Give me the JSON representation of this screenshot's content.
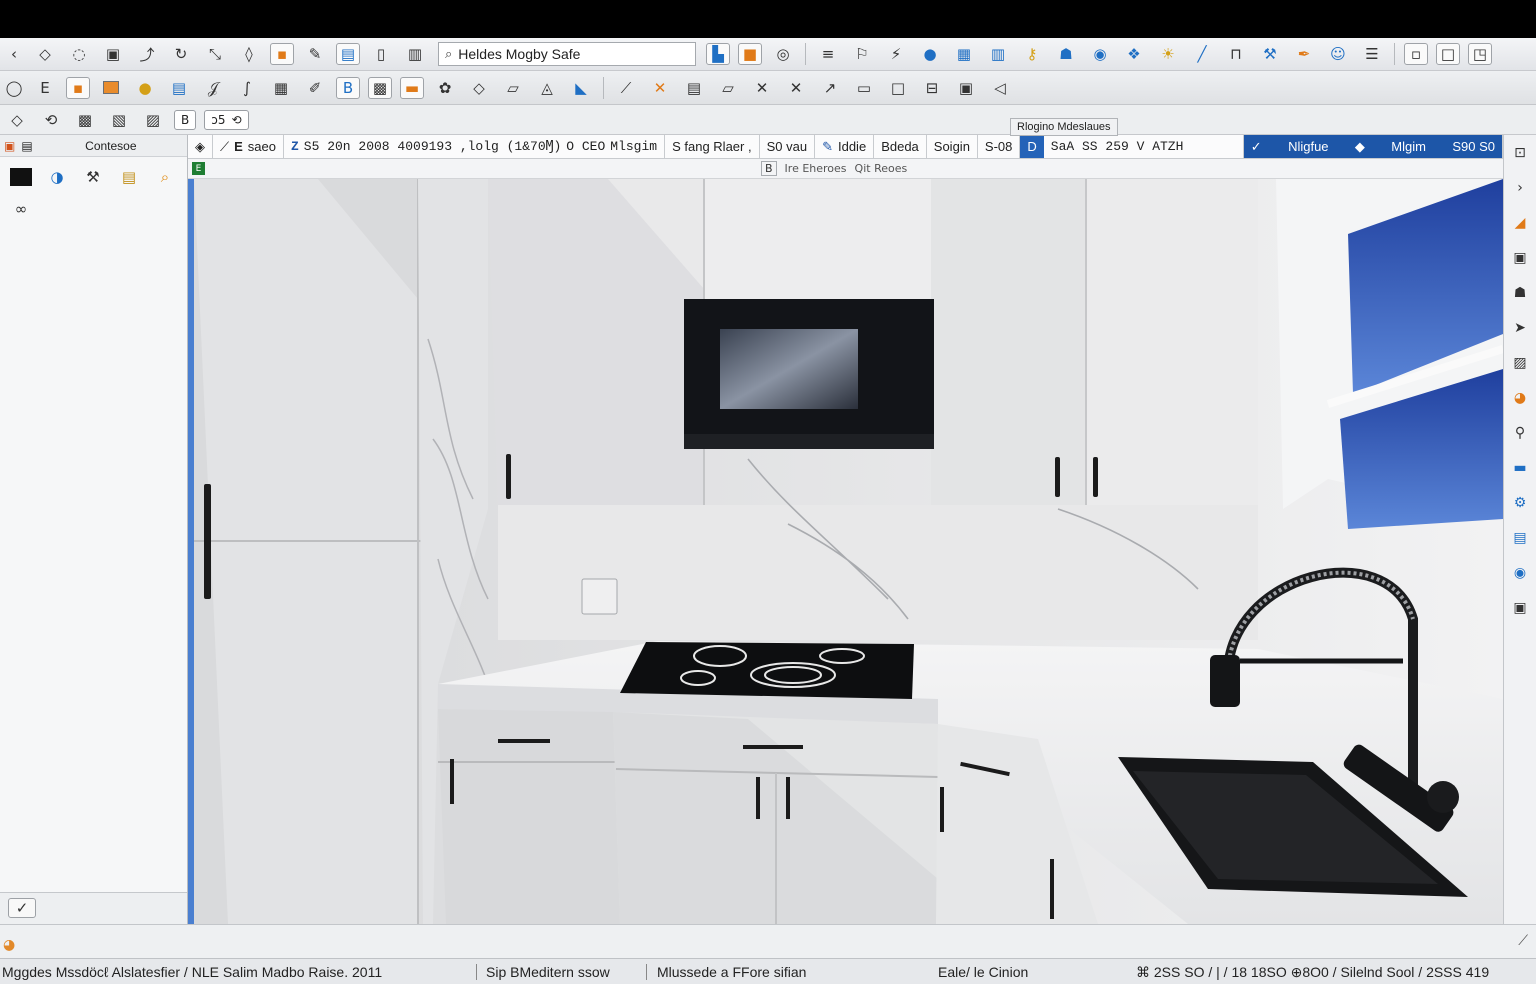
{
  "toolbar1": {
    "search_value": "Heldes Mogby Safe"
  },
  "toolbar3": {
    "pill_b": "B",
    "pill_text": "ɔ5"
  },
  "left_panel": {
    "title": "Contesoe"
  },
  "tooltip": "Rlogino Mdeslaues",
  "info_bar": {
    "e_label": "E",
    "e_value": "saeo",
    "path": "S5 20n 2008 4009193 ,lolg (1&70Ɱ)",
    "oce": "O CEO",
    "height_label": "Mlsgim",
    "scale": "S fang Rlaer ,",
    "units": "S0 vau",
    "mode": "Iddie",
    "bdeda": "Bdeda",
    "soigin": "Soigin",
    "offset": "S-08",
    "coord_label": "SaA SS 259 V ATZH",
    "nav_left": "Nligfue",
    "nav_mid": "Mlgim",
    "nav_right": "S90 S0"
  },
  "sub_bar": {
    "b_label": "B",
    "left_text": "Ire Eheroes",
    "right_text": "Qit Reoes"
  },
  "status_bar": {
    "text1": "Mggdes Mssdöcℓ Alslatesfier / NLE Salim Madbo Raise. 2011",
    "text2": "Sip BMeditern ssow",
    "text3": "Mlussede a FFore sifian",
    "text4": "Eale/ le Cinion",
    "text5": "⌘ 2SS SO / | / 18 18SO ⊕8O0 / Silelnd Sool / 2SSS 419"
  },
  "colors": {
    "accent_blue": "#2463b8",
    "titlebar": "#000000",
    "sky": "#3f68c4"
  }
}
